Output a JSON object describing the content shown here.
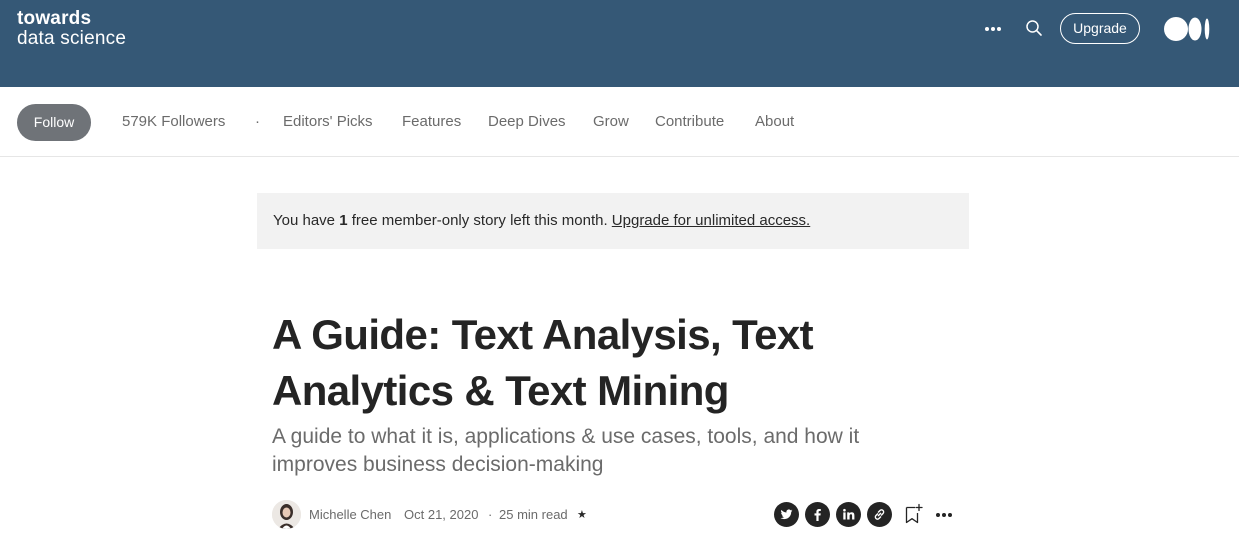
{
  "header": {
    "brand_line1": "towards",
    "brand_line2": "data science",
    "more_icon": "ellipsis-icon",
    "search_icon": "search-icon",
    "upgrade_label": "Upgrade",
    "logo_icon": "medium-logo-icon",
    "bg_color": "#355876"
  },
  "pubnav": {
    "follow_label": "Follow",
    "followers": "579K Followers",
    "separator": "·",
    "links": [
      "Editors' Picks",
      "Features",
      "Deep Dives",
      "Grow",
      "Contribute",
      "About"
    ]
  },
  "banner": {
    "prefix": "You have ",
    "count": "1",
    "suffix": " free member-only story left this month. ",
    "link": "Upgrade for unlimited access."
  },
  "article": {
    "title": "A Guide: Text Analysis, Text Analytics & Text Mining",
    "subtitle": "A guide to what it is, applications & use cases, tools, and how it improves business decision-making",
    "author": "Michelle Chen",
    "date": "Oct 21, 2020",
    "dot": "·",
    "read_time": "25 min read",
    "star": "★",
    "share_icons": [
      "twitter-icon",
      "facebook-icon",
      "linkedin-icon",
      "link-icon"
    ],
    "bookmark_icon": "bookmark-add-icon",
    "more_icon": "ellipsis-icon"
  }
}
